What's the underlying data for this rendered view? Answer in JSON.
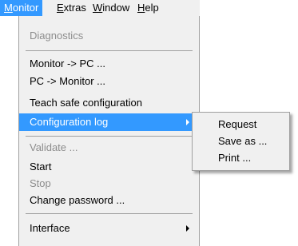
{
  "menubar": {
    "items": [
      {
        "label": "Monitor",
        "underline": "M",
        "rest": "onitor"
      },
      {
        "label": "Extras",
        "underline": "E",
        "rest": "xtras"
      },
      {
        "label": "Window",
        "underline": "W",
        "rest": "indow"
      },
      {
        "label": "Help",
        "underline": "H",
        "rest": "elp"
      }
    ],
    "active": "Monitor"
  },
  "monitor_menu": {
    "diagnostics": "Diagnostics",
    "monitor_to_pc": "Monitor -> PC ...",
    "pc_to_monitor": "PC -> Monitor ...",
    "teach_safe_configuration": "Teach safe configuration",
    "configuration_log": "Configuration log",
    "validate": "Validate ...",
    "start": "Start",
    "stop": "Stop",
    "change_password": "Change password ...",
    "interface": "Interface"
  },
  "configuration_log_submenu": {
    "request": "Request",
    "save_as": "Save as ...",
    "print": "Print ..."
  },
  "colors": {
    "highlight": "#3399ff",
    "menu_background": "#f0f0f0",
    "disabled_text": "#8d8d8d"
  }
}
